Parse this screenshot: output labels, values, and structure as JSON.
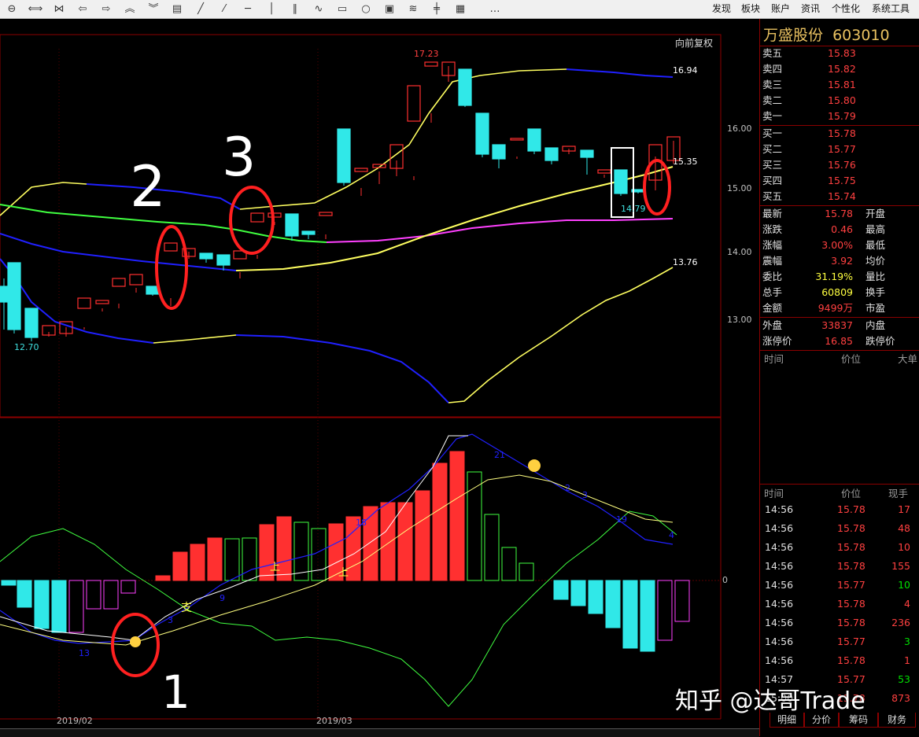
{
  "toolbar": {
    "icons": [
      "zoom-out-icon",
      "arrows-h-icon",
      "arrows-collapse-icon",
      "arrow-left-icon",
      "arrow-right-icon",
      "chevron-up-icon",
      "chevron-down-icon",
      "layout-icon",
      "line-tool-icon",
      "dashed-line-icon",
      "horizontal-line-icon",
      "vertical-line-icon",
      "parallel-line-icon",
      "wave-tool-icon",
      "rectangle-icon",
      "circle-icon",
      "text-box-icon",
      "fib-tool-icon",
      "gann-tool-icon",
      "eraser-icon",
      "more-icon"
    ],
    "more": "…",
    "menu": [
      "发现",
      "板块",
      "账户",
      "资讯",
      "个性化",
      "系统工具"
    ]
  },
  "chart": {
    "fuquan": "向前复权",
    "price_ticks": [
      "16.00",
      "15.00",
      "14.00",
      "13.00"
    ],
    "macd_zero": "0",
    "dates": [
      "2019/02",
      "2019/03"
    ],
    "price_labels": {
      "high": "17.23",
      "low": "12.70",
      "upper_band": "16.94",
      "mid_band": "15.35",
      "lower_band": "13.76",
      "marker": "14.79"
    },
    "annotations": {
      "n1": "1",
      "n2": "2",
      "n3": "3"
    },
    "macd_markers": {
      "zhi": "支",
      "shang1": "上",
      "shang2": "上"
    },
    "macd_numbers": [
      "13",
      "3",
      "9",
      "18",
      "21",
      "2",
      "3",
      "19",
      "4"
    ]
  },
  "panel": {
    "name": "万盛股份",
    "code": "603010",
    "sell": [
      {
        "label": "卖五",
        "price": "15.83"
      },
      {
        "label": "卖四",
        "price": "15.82"
      },
      {
        "label": "卖三",
        "price": "15.81"
      },
      {
        "label": "卖二",
        "price": "15.80"
      },
      {
        "label": "卖一",
        "price": "15.79"
      }
    ],
    "buy": [
      {
        "label": "买一",
        "price": "15.78"
      },
      {
        "label": "买二",
        "price": "15.77"
      },
      {
        "label": "买三",
        "price": "15.76"
      },
      {
        "label": "买四",
        "price": "15.75"
      },
      {
        "label": "买五",
        "price": "15.74"
      }
    ],
    "stats": [
      {
        "label": "最新",
        "value": "15.78",
        "label2": "开盘"
      },
      {
        "label": "涨跌",
        "value": "0.46",
        "label2": "最高"
      },
      {
        "label": "涨幅",
        "value": "3.00%",
        "label2": "最低"
      },
      {
        "label": "震幅",
        "value": "3.92",
        "label2": "均价"
      },
      {
        "label": "委比",
        "value": "31.19%",
        "label2": "量比"
      },
      {
        "label": "总手",
        "value": "60809",
        "label2": "换手"
      },
      {
        "label": "金额",
        "value": "9499万",
        "label2": "市盈"
      }
    ],
    "waipan": {
      "label": "外盘",
      "value": "33837",
      "label2": "内盘"
    },
    "zhangting": {
      "label": "涨停价",
      "value": "16.85",
      "label2": "跌停价"
    },
    "bigorder_headers": [
      "时间",
      "价位",
      "大单"
    ],
    "tick_headers": [
      "时间",
      "价位",
      "现手"
    ],
    "ticks": [
      {
        "time": "14:56",
        "price": "15.78",
        "vol": "17"
      },
      {
        "time": "14:56",
        "price": "15.78",
        "vol": "48"
      },
      {
        "time": "14:56",
        "price": "15.78",
        "vol": "10"
      },
      {
        "time": "14:56",
        "price": "15.78",
        "vol": "155"
      },
      {
        "time": "14:56",
        "price": "15.77",
        "vol": "10"
      },
      {
        "time": "14:56",
        "price": "15.78",
        "vol": "4"
      },
      {
        "time": "14:56",
        "price": "15.78",
        "vol": "236"
      },
      {
        "time": "14:56",
        "price": "15.77",
        "vol": "3"
      },
      {
        "time": "14:56",
        "price": "15.78",
        "vol": "1"
      },
      {
        "time": "14:57",
        "price": "15.77",
        "vol": "53"
      },
      {
        "time": "15:00",
        "price": "15.78",
        "vol": "873"
      }
    ],
    "tabs": [
      "明细",
      "分价",
      "筹码",
      "财务"
    ]
  },
  "watermark": "知乎 @达哥Trade",
  "colors": {
    "up": "#ff3030",
    "down": "#30e8e8",
    "ma_yellow": "#ffff60",
    "ma_blue": "#2020ff",
    "ma_green": "#40ff40",
    "ma_magenta": "#ff40ff",
    "frame": "#8b0000",
    "annotation": "#ff2020"
  }
}
